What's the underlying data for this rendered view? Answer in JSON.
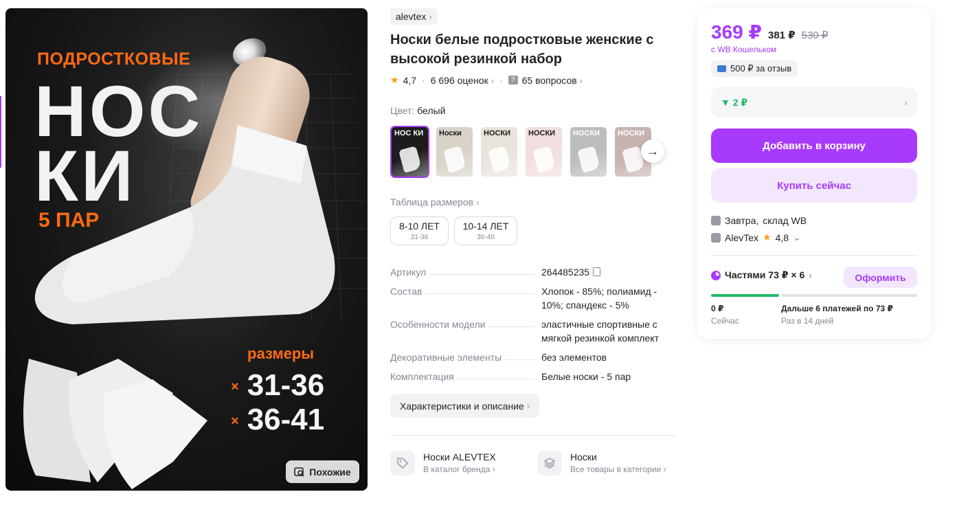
{
  "product_image": {
    "headline_small": "ПОДРОСТКОВЫЕ",
    "headline_big_line1": "НОС",
    "headline_big_line2": "КИ",
    "pairs": "5 ПАР",
    "sizes_label": "размеры",
    "size_range_1": "31-36",
    "size_range_2": "36-41",
    "size_marker": "×",
    "similar_button": "Похожие"
  },
  "brand": {
    "name": "alevtex"
  },
  "product": {
    "title": "Носки белые подростковые женские с высокой резинкой набор",
    "rating": "4,7",
    "reviews": "6 696 оценок",
    "questions": "65 вопросов"
  },
  "color": {
    "label": "Цвет:",
    "value": "белый"
  },
  "thumbnails": [
    {
      "label": "НОС КИ",
      "bg": "#1c1c1c",
      "fg": "#ffffff",
      "icon": "socks-black-bg"
    },
    {
      "label": "Носки",
      "bg": "#d8d2c8",
      "fg": "#1a1a1a",
      "icon": "colorful-socks"
    },
    {
      "label": "НОСКИ",
      "bg": "#e9e4dc",
      "fg": "#1a1a1a",
      "icon": "black-socks"
    },
    {
      "label": "НОСКИ",
      "bg": "#f2dede",
      "fg": "#1a1a1a",
      "icon": "pastel-socks"
    },
    {
      "label": "НОСКИ",
      "bg": "#bdbdbd",
      "fg": "#ffffff",
      "icon": "white-socks"
    },
    {
      "label": "НОСКИ",
      "bg": "#c7b3b0",
      "fg": "#ffffff",
      "icon": "pink-socks"
    }
  ],
  "size_table_link": "Таблица размеров",
  "sizes": [
    {
      "main": "8-10 ЛЕТ",
      "sub": "31-36"
    },
    {
      "main": "10-14 ЛЕТ",
      "sub": "36-40"
    }
  ],
  "specs": [
    {
      "key": "Артикул",
      "value": "264485235"
    },
    {
      "key": "Состав",
      "value": "Хлопок - 85%; полиамид - 10%; спандекс - 5%"
    },
    {
      "key": "Особенности модели",
      "value": "эластичные спортивные с мягкой резинкой комплект"
    },
    {
      "key": "Декоративные элементы",
      "value": "без элементов"
    },
    {
      "key": "Комплектация",
      "value": "Белые носки - 5 пар"
    }
  ],
  "characteristics_button": "Характеристики и описание",
  "category_links": [
    {
      "name": "Носки ALEVTEX",
      "sub": "В каталог бренда",
      "icon": "tag-icon"
    },
    {
      "name": "Носки",
      "sub": "Все товары в категории",
      "icon": "layers-icon"
    }
  ],
  "buy_card": {
    "price": "369 ₽",
    "price_regular": "381 ₽",
    "price_old": "530 ₽",
    "wallet_note": "с WB Кошельком",
    "review_bonus": "500 ₽ за отзыв",
    "cashback": "▼ 2 ₽",
    "add_to_cart": "Добавить в корзину",
    "buy_now": "Купить сейчас",
    "delivery": "Завтра,",
    "delivery_warehouse": "склад WB",
    "seller": "AlevTex",
    "seller_rating": "4,8",
    "installments": "Частями 73 ₽ × 6",
    "apply_button": "Оформить",
    "installment_progress": 0.333,
    "pay_now_amount": "0 ₽",
    "pay_now_label": "Сейчас",
    "pay_later_amount": "Дальше 6 платежей по 73 ₽",
    "pay_later_label": "Раз в 14 дней"
  },
  "colors": {
    "accent": "#a73afd",
    "accent_light": "#f3e6ff",
    "green": "#22bb6a",
    "orange": "#ff6a13",
    "star": "#ff9a13"
  }
}
